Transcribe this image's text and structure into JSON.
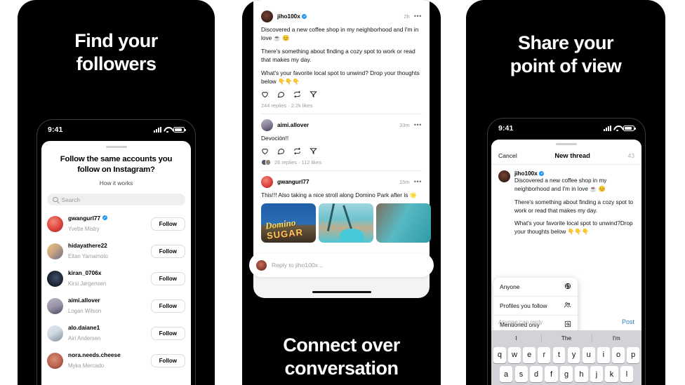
{
  "panels": {
    "left": {
      "headline_line1": "Find your",
      "headline_line2": "followers",
      "status": {
        "time": "9:41"
      },
      "sheet": {
        "title": "Follow the same accounts you follow on Instagram?",
        "subtitle": "How it works",
        "search_placeholder": "Search",
        "follow_label": "Follow",
        "users": [
          {
            "username": "gwangurl77",
            "fullname": "Yvette Mistry",
            "verified": true,
            "color1": "#e0413c",
            "color2": "#8d2c2e"
          },
          {
            "username": "hidayathere22",
            "fullname": "Eitan Yamamoto",
            "verified": false,
            "color1": "#e7c77a",
            "color2": "#6d6a84"
          },
          {
            "username": "kiran_0706x",
            "fullname": "Kirsi Jørgensen",
            "verified": false,
            "color1": "#1b2433",
            "color2": "#0a0d13"
          },
          {
            "username": "aimi.allover",
            "fullname": "Logan Wilson",
            "verified": false,
            "color1": "#9a93a8",
            "color2": "#4e4a5c"
          },
          {
            "username": "alo.daiane1",
            "fullname": "Airi Andersen",
            "verified": false,
            "color1": "#cfd9e2",
            "color2": "#7d8a99"
          },
          {
            "username": "nora.needs.cheese",
            "fullname": "Myka Mercado",
            "verified": false,
            "color1": "#b9634f",
            "color2": "#6d2f2c"
          }
        ]
      }
    },
    "middle": {
      "headline_line1": "Connect over",
      "headline_line2": "conversation",
      "compose_placeholder": "Reply to jiho100x...",
      "posts": [
        {
          "username": "jiho100x",
          "verified": true,
          "time": "2h",
          "paragraphs": [
            "Discovered a new coffee shop in my neighborhood and I'm in love ☕️ 😊",
            "There's something about finding a cozy spot to work or read that makes my day.",
            "What's your favorite local spot to unwind? Drop your thoughts below 👇👇👇"
          ],
          "meta": "244 replies · 2.2k likes",
          "has_facepile": false,
          "thumbs": []
        },
        {
          "username": "aimi.allover",
          "verified": false,
          "time": "33m",
          "paragraphs": [
            "Devoción!!"
          ],
          "meta": "26 replies · 112 likes",
          "has_facepile": true,
          "thumbs": []
        },
        {
          "username": "gwangurl77",
          "verified": false,
          "time": "15m",
          "paragraphs": [
            "This!!! Also taking a nice stroll along Domino Park after is 🌟"
          ],
          "meta": "",
          "has_facepile": false,
          "thumbs": [
            "domino-sugar-sign",
            "teal-industrial-walkway",
            "teal-structure"
          ]
        }
      ],
      "more_icon": "•••"
    },
    "right": {
      "headline_line1": "Share your",
      "headline_line2": "point of view",
      "status": {
        "time": "9:41"
      },
      "composer": {
        "cancel_label": "Cancel",
        "title": "New thread",
        "char_count": "43",
        "username": "jiho100x",
        "verified": true,
        "paragraphs": [
          "Discovered a new coffee shop in my neighborhood and I'm in love ☕️ 😊",
          "There's something about finding a cozy spot to work or read that makes my day.",
          "What's your favorite local spot to unwind?Drop your thoughts below 👇👇👇"
        ],
        "reply_note": "Anyone can reply",
        "post_label": "Post"
      },
      "dropdown": {
        "items": [
          {
            "label": "Anyone",
            "icon": "globe-icon",
            "glyph": "🌐"
          },
          {
            "label": "Profiles you follow",
            "icon": "people-icon",
            "glyph": "👥"
          },
          {
            "label": "Mentioned only",
            "icon": "at-icon",
            "glyph": "@"
          }
        ]
      },
      "keyboard": {
        "suggestions": [
          "I",
          "The",
          "I'm"
        ],
        "row1": [
          "q",
          "w",
          "e",
          "r",
          "t",
          "y",
          "u",
          "i",
          "o",
          "p"
        ],
        "row2": [
          "a",
          "s",
          "d",
          "f",
          "g",
          "h",
          "j",
          "k",
          "l"
        ]
      }
    }
  },
  "colors": {
    "black": "#000000",
    "white": "#ffffff",
    "accent_blue": "#2196f3",
    "post_link": "#2c7fb8",
    "muted": "#9d9d9d"
  }
}
